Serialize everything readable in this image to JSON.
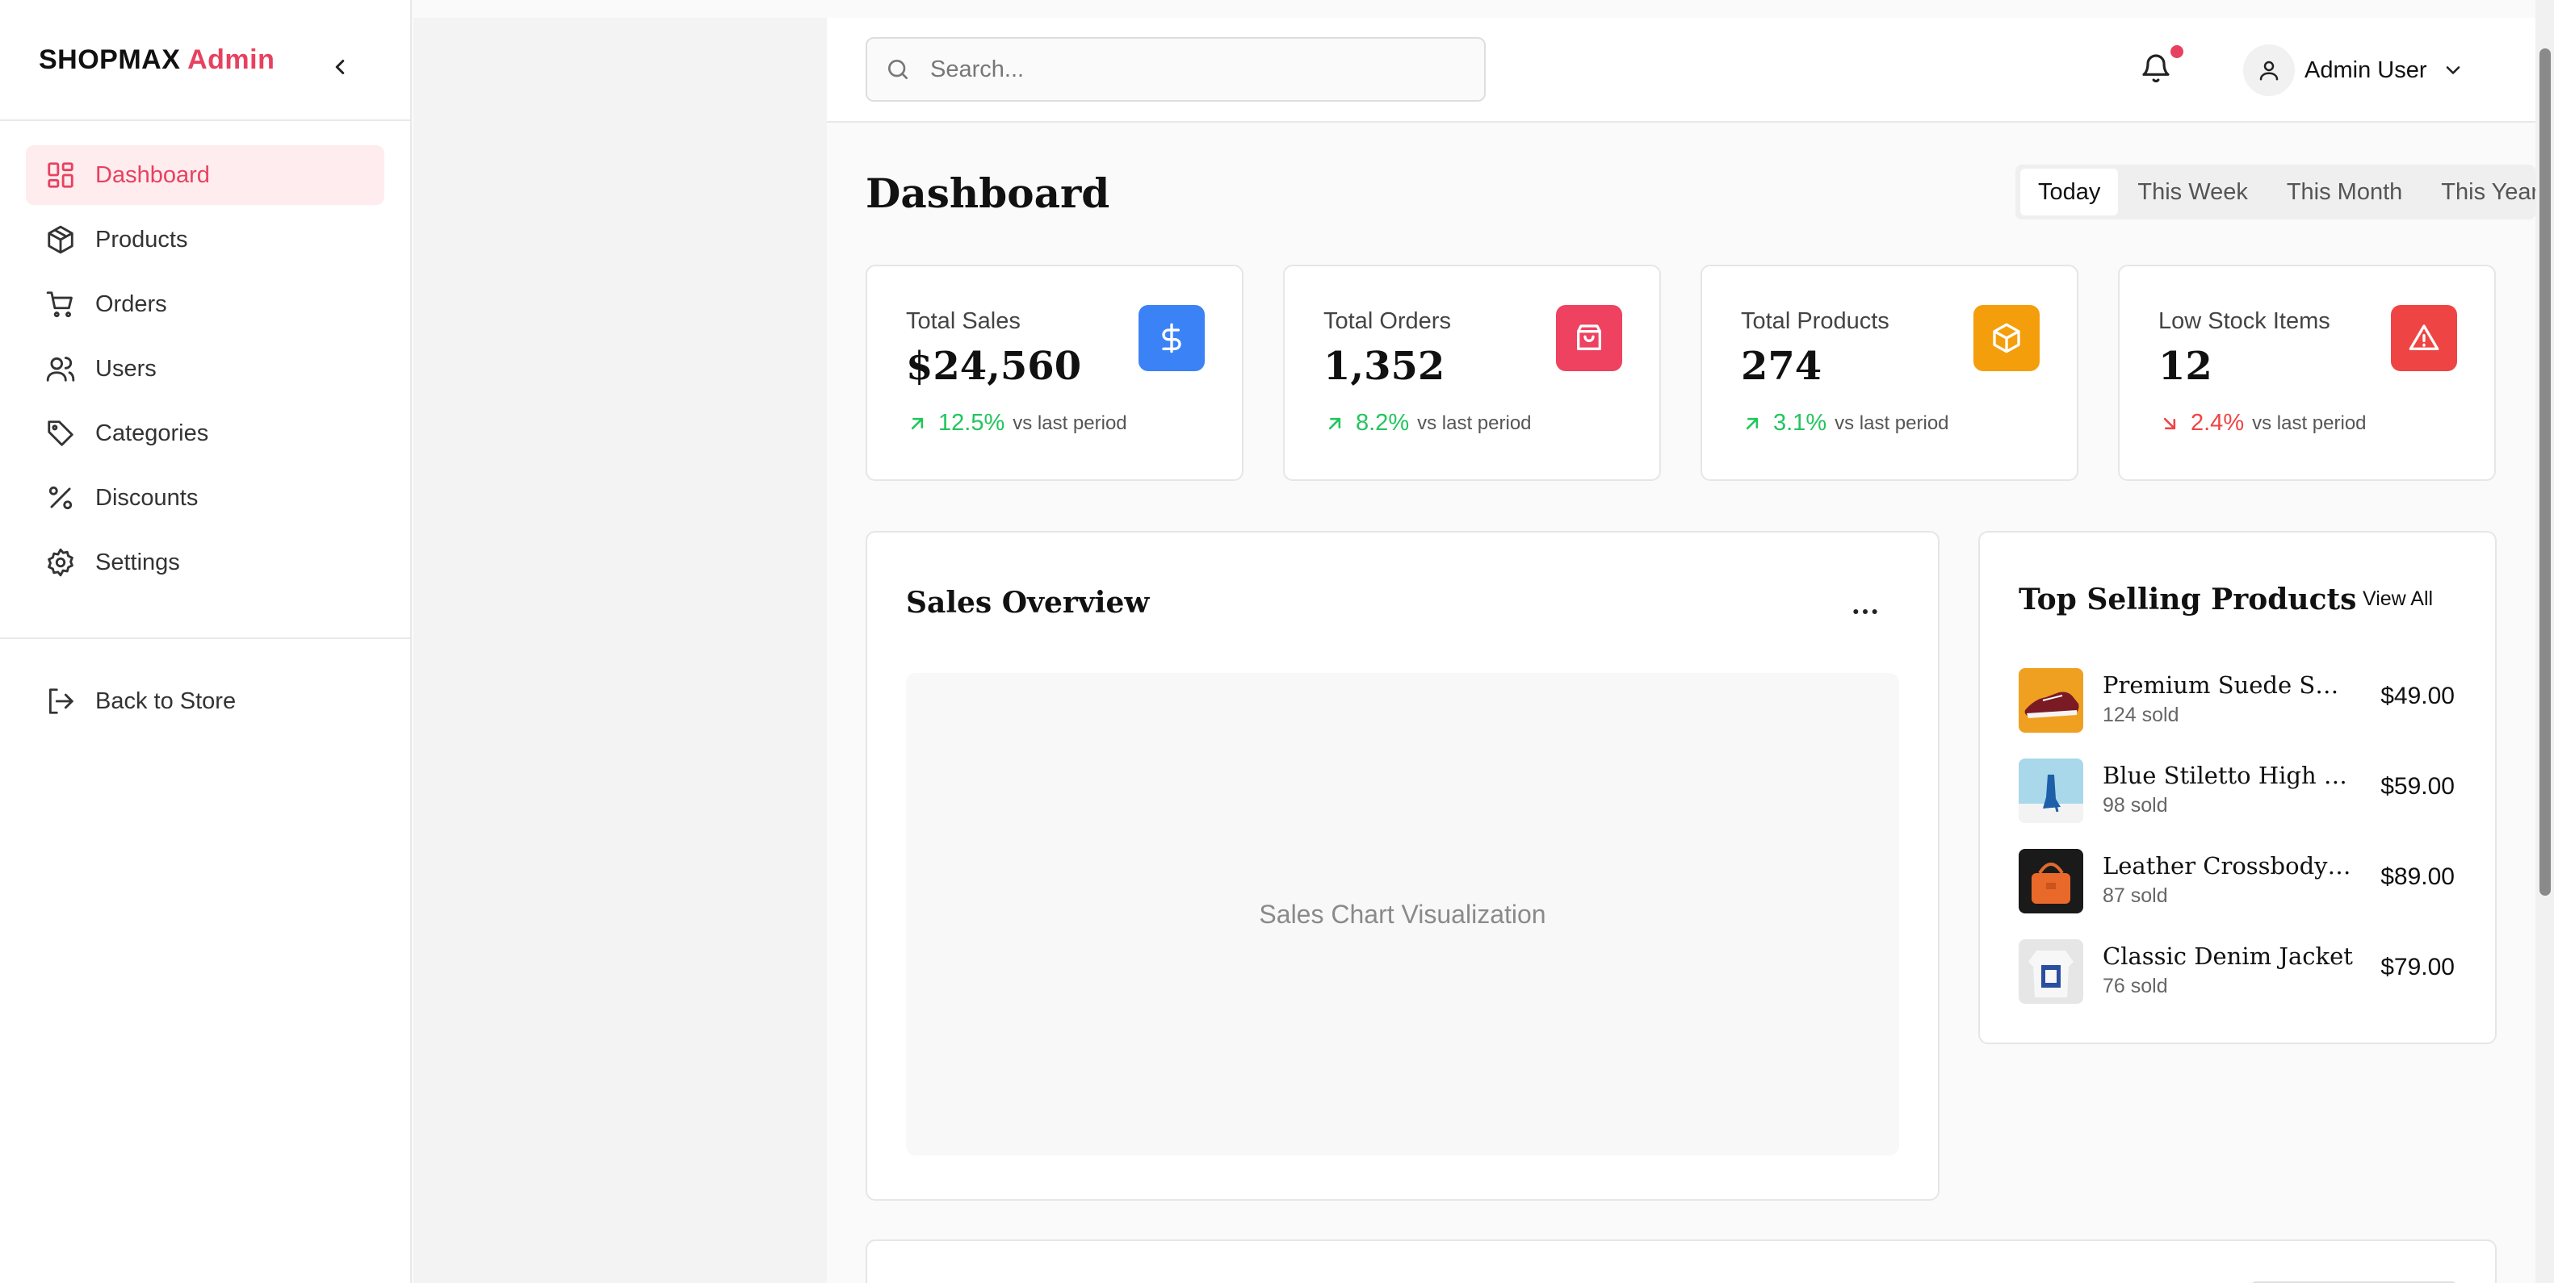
{
  "brand": {
    "name": "SHOPMAX",
    "accent": "Admin"
  },
  "sidebar": {
    "items": [
      {
        "label": "Dashboard",
        "icon": "dashboard-grid-icon",
        "active": true
      },
      {
        "label": "Products",
        "icon": "box-icon"
      },
      {
        "label": "Orders",
        "icon": "cart-icon"
      },
      {
        "label": "Users",
        "icon": "users-icon"
      },
      {
        "label": "Categories",
        "icon": "tag-icon"
      },
      {
        "label": "Discounts",
        "icon": "percent-icon"
      },
      {
        "label": "Settings",
        "icon": "gear-icon"
      }
    ],
    "back_label": "Back to Store"
  },
  "topbar": {
    "search_placeholder": "Search...",
    "notification_dot": true,
    "user_name": "Admin User"
  },
  "main": {
    "title": "Dashboard",
    "periods": [
      "Today",
      "This Week",
      "This Month",
      "This Year"
    ],
    "active_period": "Today"
  },
  "stats": [
    {
      "label": "Total Sales",
      "value": "$24,560",
      "change": "12.5%",
      "trend": "up",
      "note": "vs last period",
      "icon": "dollar-icon",
      "color": "#3b82f6"
    },
    {
      "label": "Total Orders",
      "value": "1,352",
      "change": "8.2%",
      "trend": "up",
      "note": "vs last period",
      "icon": "shopping-bag-icon",
      "color": "#ef4160"
    },
    {
      "label": "Total Products",
      "value": "274",
      "change": "3.1%",
      "trend": "up",
      "note": "vs last period",
      "icon": "package-icon",
      "color": "#f59e0b"
    },
    {
      "label": "Low Stock Items",
      "value": "12",
      "change": "2.4%",
      "trend": "down",
      "note": "vs last period",
      "icon": "alert-triangle-icon",
      "color": "#ef4444"
    }
  ],
  "sales_overview": {
    "title": "Sales Overview",
    "placeholder": "Sales Chart Visualization"
  },
  "top_products": {
    "title": "Top Selling Products",
    "view_all": "View All",
    "items": [
      {
        "name": "Premium Suede Sneak...",
        "sold": "124 sold",
        "price": "$49.00"
      },
      {
        "name": "Blue Stiletto High Heels",
        "sold": "98 sold",
        "price": "$59.00"
      },
      {
        "name": "Leather Crossbody Bag",
        "sold": "87 sold",
        "price": "$89.00"
      },
      {
        "name": "Classic Denim Jacket",
        "sold": "76 sold",
        "price": "$79.00"
      }
    ]
  },
  "colors": {
    "accent": "#e8415f",
    "up": "#22c55e",
    "down": "#ef4444"
  }
}
